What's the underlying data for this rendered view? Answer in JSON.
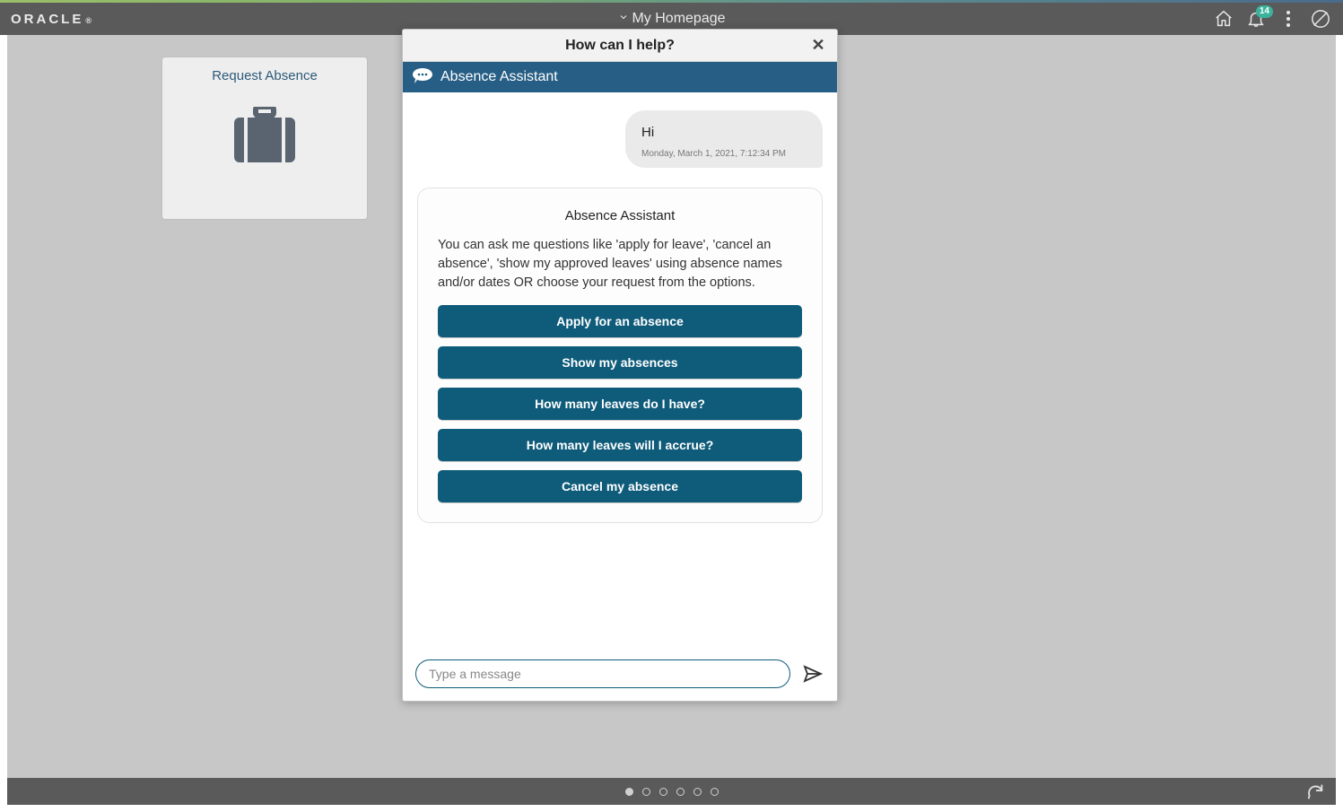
{
  "header": {
    "brand": "ORACLE",
    "title": "My Homepage",
    "notification_count": "14"
  },
  "tile": {
    "title": "Request Absence"
  },
  "dialog": {
    "title": "How can I help?",
    "assistant_name": "Absence Assistant",
    "user_message": {
      "text": "Hi",
      "timestamp": "Monday, March 1, 2021, 7:12:34 PM"
    },
    "card": {
      "title": "Absence Assistant",
      "description": "You can ask me questions like 'apply for leave', 'cancel an absence', 'show my approved leaves' using absence names and/or dates OR choose your request from the options.",
      "options": [
        "Apply for an absence",
        "Show my absences",
        "How many leaves do I have?",
        "How many leaves will I accrue?",
        "Cancel my absence"
      ]
    },
    "input_placeholder": "Type a message"
  },
  "pager": {
    "count": 6,
    "active": 0
  }
}
